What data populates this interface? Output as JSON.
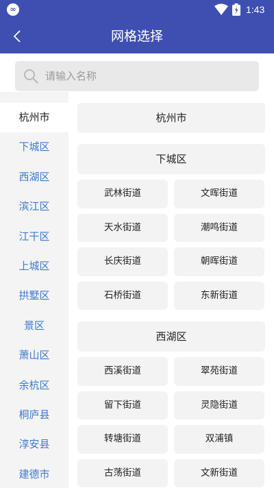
{
  "status": {
    "time": "1:43"
  },
  "header": {
    "title": "网格选择"
  },
  "search": {
    "placeholder": "请输入名称"
  },
  "sidebar": {
    "items": [
      {
        "label": "杭州市"
      },
      {
        "label": "下城区"
      },
      {
        "label": "西湖区"
      },
      {
        "label": "滨江区"
      },
      {
        "label": "江干区"
      },
      {
        "label": "上城区"
      },
      {
        "label": "拱墅区"
      },
      {
        "label": "景区"
      },
      {
        "label": "萧山区"
      },
      {
        "label": "余杭区"
      },
      {
        "label": "桐庐县"
      },
      {
        "label": "淳安县"
      },
      {
        "label": "建德市"
      }
    ]
  },
  "content": {
    "city": "杭州市",
    "sections": [
      {
        "title": "下城区",
        "items": [
          "武林街道",
          "文晖街道",
          "天水街道",
          "潮鸣街道",
          "长庆街道",
          "朝晖街道",
          "石桥街道",
          "东新街道"
        ]
      },
      {
        "title": "西湖区",
        "items": [
          "西溪街道",
          "翠苑街道",
          "留下街道",
          "灵隐街道",
          "转塘街道",
          "双浦镇",
          "古荡街道",
          "文新街道"
        ]
      }
    ]
  },
  "colors": {
    "header": "#3f4fb1",
    "sidebar_text": "#3d79d4",
    "sidebar_bg": "#f4f4f4",
    "tile_bg": "#f3f3f3"
  }
}
